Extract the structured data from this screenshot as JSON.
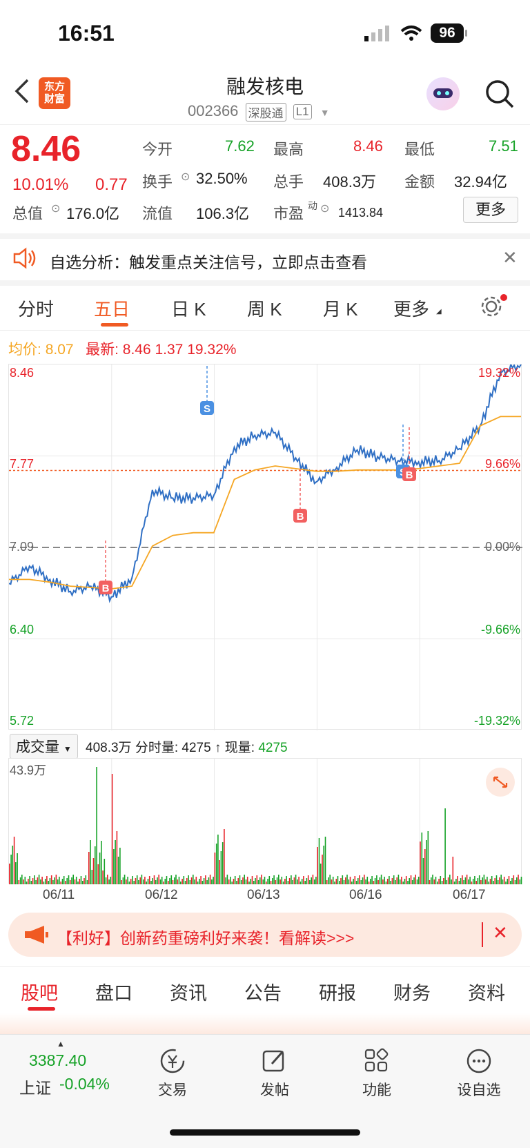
{
  "status_bar": {
    "time": "16:51",
    "battery": "96"
  },
  "header": {
    "logo_line1": "东方",
    "logo_line2": "财富",
    "stock_name": "融发核电",
    "stock_code": "002366",
    "tag_market": "深股通",
    "tag_level": "L1"
  },
  "quote": {
    "price": "8.46",
    "change_pct": "10.01%",
    "change": "0.77",
    "open_label": "今开",
    "open": "7.62",
    "high_label": "最高",
    "high": "8.46",
    "low_label": "最低",
    "low": "7.51",
    "turnover_label": "换手",
    "turnover": "32.50%",
    "volume_label": "总手",
    "volume": "408.3万",
    "amount_label": "金额",
    "amount": "32.94亿",
    "mcap_label": "总值",
    "mcap": "176.0亿",
    "float_label": "流值",
    "float_cap": "106.3亿",
    "pe_label": "市盈",
    "pe_sup": "动",
    "pe": "1413.84",
    "more": "更多"
  },
  "alert": {
    "text": "自选分析：触发重点关注信号，立即点击查看"
  },
  "chart_tabs": [
    "分时",
    "五日",
    "日 K",
    "周 K",
    "月 K",
    "更多"
  ],
  "chart_legend": {
    "avg_label": "均价:",
    "avg": "8.07",
    "latest_label": "最新:",
    "latest": "8.46",
    "chg": "1.37",
    "chg_pct": "19.32%"
  },
  "chart_data": {
    "type": "line",
    "title": "",
    "x": [
      "06/11",
      "06/12",
      "06/13",
      "06/16",
      "06/17"
    ],
    "y_ticks_left": [
      "8.46",
      "7.77",
      "7.09",
      "6.40",
      "5.72"
    ],
    "y_ticks_right": [
      "19.32%",
      "9.66%",
      "0.00%",
      "-9.66%",
      "-19.32%"
    ],
    "ylim": [
      5.72,
      8.46
    ],
    "prev_close": 7.09,
    "series": [
      {
        "name": "",
        "color": "#2f6fc4",
        "values": [
          6.82,
          6.95,
          6.85,
          6.76,
          6.8,
          6.72,
          6.86,
          7.52,
          7.46,
          7.46,
          7.48,
          7.84,
          7.93,
          7.95,
          7.76,
          7.58,
          7.69,
          7.82,
          7.77,
          7.74,
          7.73,
          7.74,
          7.83,
          8.0,
          8.4,
          8.46
        ]
      },
      {
        "name": "",
        "color": "#f5a623",
        "values": [
          6.85,
          6.85,
          6.83,
          6.8,
          6.79,
          6.78,
          6.8,
          7.1,
          7.18,
          7.2,
          7.2,
          7.6,
          7.67,
          7.7,
          7.68,
          7.66,
          7.66,
          7.67,
          7.67,
          7.67,
          7.68,
          7.7,
          7.72,
          8.0,
          8.07,
          8.07
        ]
      }
    ],
    "markers": [
      {
        "label": "B",
        "type": "buy",
        "day": "06/11"
      },
      {
        "label": "S",
        "type": "sell",
        "day": "06/13"
      },
      {
        "label": "B",
        "type": "buy",
        "day": "06/13"
      },
      {
        "label": "S",
        "type": "sell",
        "day": "06/17"
      },
      {
        "label": "B",
        "type": "buy",
        "day": "06/17"
      }
    ],
    "grid": true
  },
  "volume": {
    "selector": "成交量",
    "total": "408.3万",
    "tick_label": "分时量:",
    "tick_value": "4275",
    "now_label": "现量:",
    "now_value": "4275",
    "max_label": "43.9万"
  },
  "promo": {
    "text": "【利好】创新药重磅利好来袭！看解读>>>"
  },
  "bottom_tabs": [
    "股吧",
    "盘口",
    "资讯",
    "公告",
    "研报",
    "财务",
    "资料"
  ],
  "bottom_bar": {
    "index_value": "3387.40",
    "index_label": "上证",
    "index_change": "-0.04%",
    "items": [
      "交易",
      "发帖",
      "功能",
      "设自选"
    ]
  },
  "colors": {
    "accent": "#f05a23",
    "up": "#e8232a",
    "down": "#16a227",
    "price_line": "#2f6fc4",
    "avg_line": "#f5a623"
  }
}
